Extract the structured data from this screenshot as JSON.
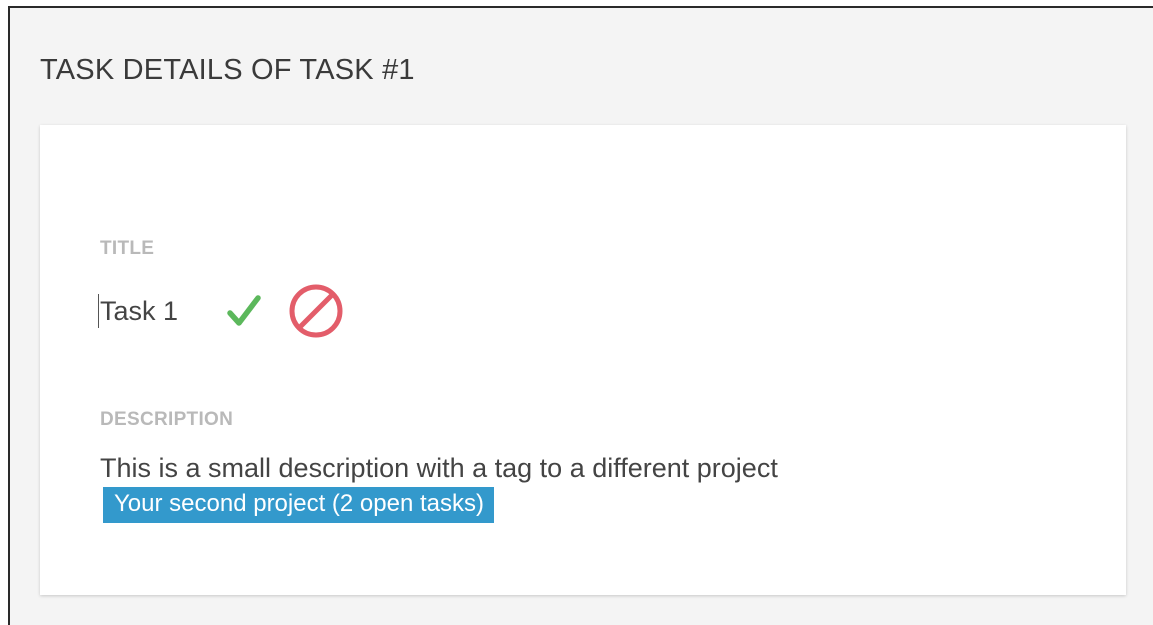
{
  "header": {
    "title": "TASK DETAILS OF TASK #1"
  },
  "title_field": {
    "label": "TITLE",
    "value": "Task 1",
    "confirm_icon": "checkmark-icon",
    "cancel_icon": "prohibited-icon"
  },
  "description_field": {
    "label": "DESCRIPTION",
    "text": "This is a small description with a tag to a different project",
    "tag_label": "Your second project (2 open tasks)"
  },
  "colors": {
    "confirm": "#5cb85c",
    "cancel": "#e35d6a",
    "tag_background": "#3399cc"
  }
}
